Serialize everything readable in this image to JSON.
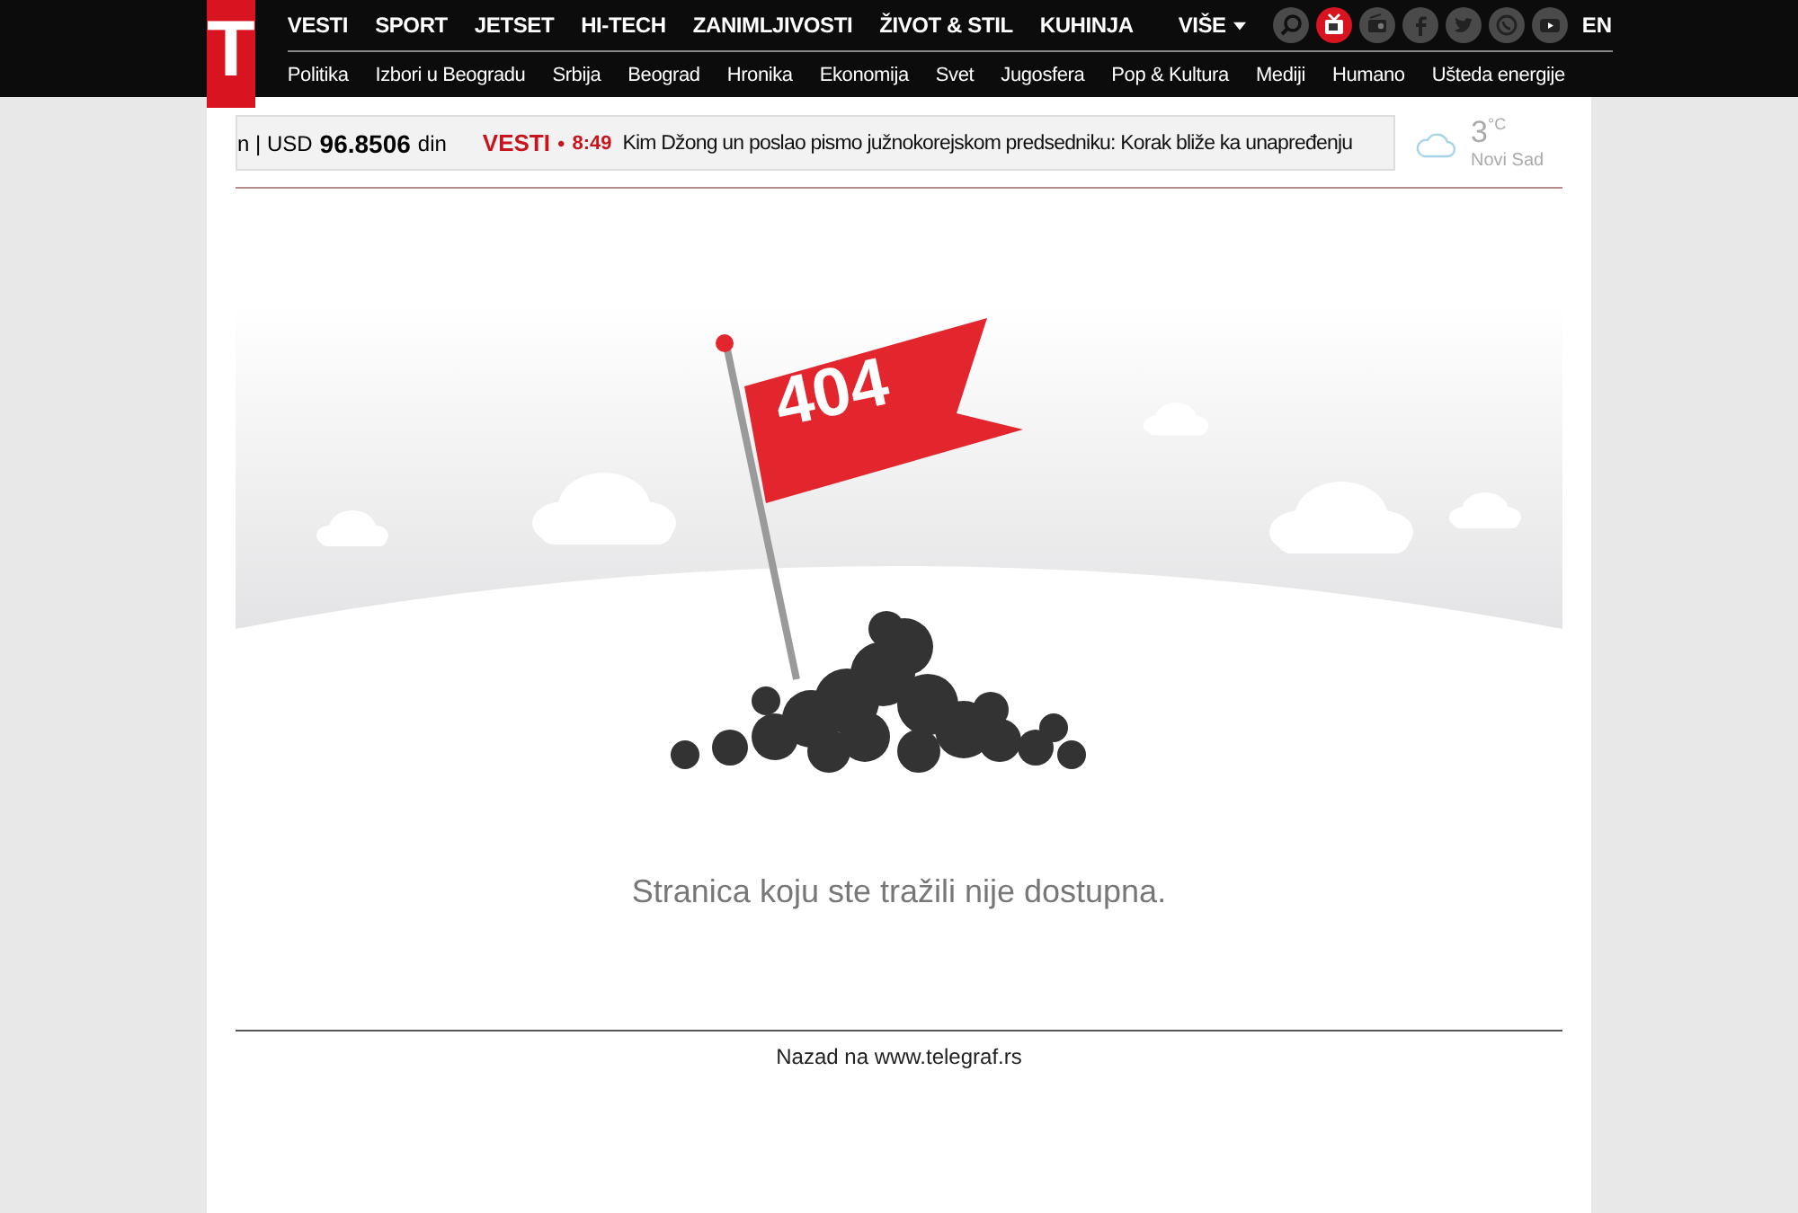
{
  "header": {
    "logo": "T",
    "main_nav": [
      {
        "label": "VESTI"
      },
      {
        "label": "SPORT"
      },
      {
        "label": "JETSET"
      },
      {
        "label": "HI-TECH"
      },
      {
        "label": "ZANIMLJIVOSTI"
      },
      {
        "label": "ŽIVOT & STIL"
      },
      {
        "label": "KUHINJA"
      },
      {
        "label": "VIŠE",
        "kind": "dropdown"
      }
    ],
    "icons": [
      {
        "kind": "search"
      },
      {
        "kind": "tv"
      },
      {
        "kind": "radio"
      },
      {
        "kind": "facebook"
      },
      {
        "kind": "twitter"
      },
      {
        "kind": "viber"
      },
      {
        "kind": "youtube"
      }
    ],
    "language": "EN",
    "sub_nav": [
      "Politika",
      "Izbori u Beogradu",
      "Srbija",
      "Beograd",
      "Hronika",
      "Ekonomija",
      "Svet",
      "Jugosfera",
      "Pop & Kultura",
      "Mediji",
      "Humano",
      "Ušteda energije"
    ]
  },
  "ticker": {
    "prefix": "n | USD",
    "rate": "96.8506",
    "currency": "din",
    "section": "VESTI",
    "bullet": "•",
    "time": "8:49",
    "headline": "Kim Džong un poslao pismo južnokorejskom predsedniku: Korak bliže ka unapređenju"
  },
  "weather": {
    "temperature": "3",
    "unit": "°C",
    "city": "Novi Sad"
  },
  "error": {
    "flag_text": "404",
    "message": "Stranica koju ste tražili nije dostupna."
  },
  "footer": {
    "back_link": "Nazad na www.telegraf.rs"
  }
}
